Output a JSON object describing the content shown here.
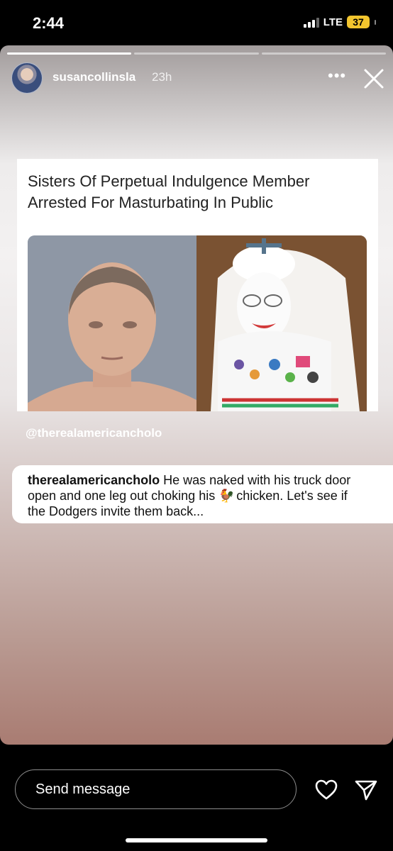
{
  "status": {
    "time": "2:44",
    "network": "LTE",
    "battery": "37"
  },
  "story": {
    "progress": [
      1.0,
      0.0,
      0.0
    ],
    "username": "susancollinsla",
    "time_ago": "23h",
    "more_icon": "more-dots-icon",
    "close_icon": "close-icon"
  },
  "article": {
    "title": "Sisters Of Perpetual Indulgence Member Arrested For Masturbating In Public"
  },
  "mention": "@therealamericancholo",
  "comment": {
    "user": "therealamericancholo",
    "text_before": "He was naked with his truck door open and one leg out choking his",
    "emoji": "🐓",
    "text_after": "chicken. Let's see if the Dodgers invite them back..."
  },
  "footer": {
    "reply_placeholder": "Send message",
    "like_icon": "heart-icon",
    "share_icon": "send-icon"
  }
}
